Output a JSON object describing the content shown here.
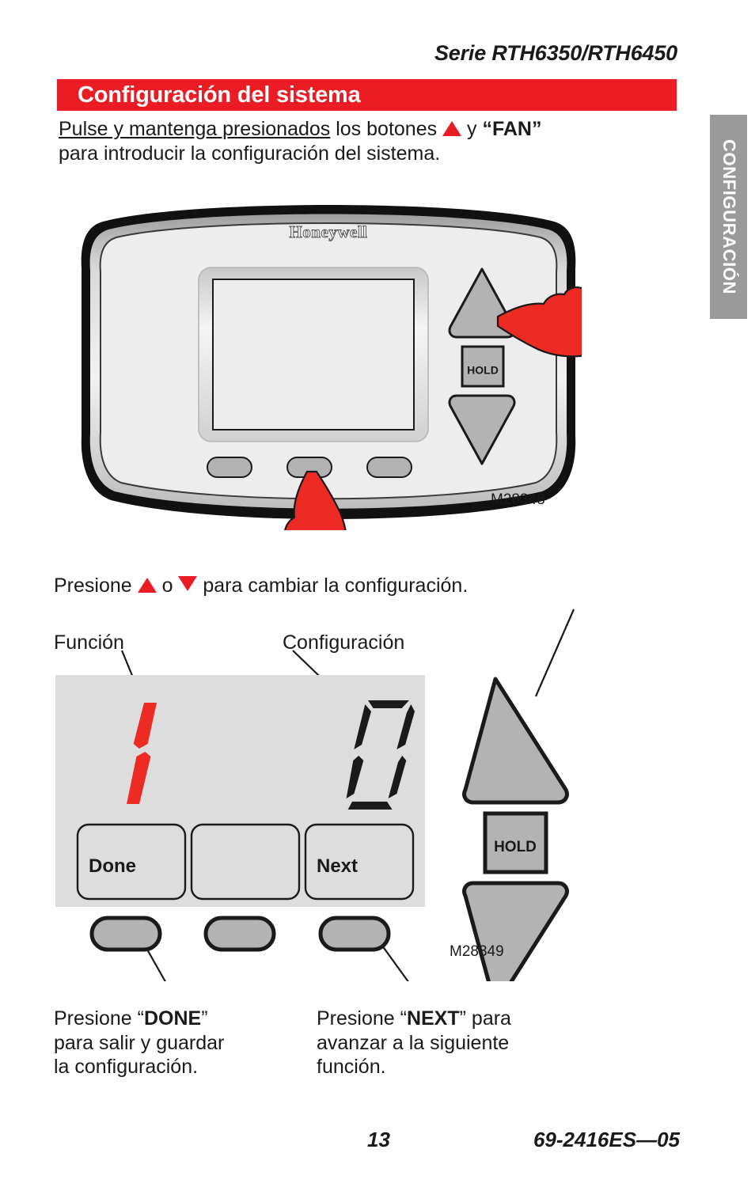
{
  "header": {
    "series": "Serie RTH6350/RTH6450",
    "banner_title": "Configuración del sistema",
    "banner_color": "#ec1c24",
    "intro_underlined": "Pulse y mantenga presionados",
    "intro_mid": " los botones ",
    "intro_up_arrow_icon": "triangle-up-red",
    "intro_join": " y ",
    "intro_fan": "“FAN”",
    "intro_line2": "para introducir la configuración del sistema."
  },
  "side_tab": {
    "label": "CONFIGURACIÓN",
    "background": "#9a9a9a",
    "text_color": "#ffffff"
  },
  "figure1": {
    "brand": "Honeywell",
    "hold_label": "HOLD",
    "code": "M28348",
    "hand_color": "#ee2a24",
    "key_color": "#b3b3b3",
    "body_color": "#eaeaea"
  },
  "middle": {
    "instruction_pre": "Presione ",
    "up_arrow_icon": "triangle-up-red",
    "instruction_o": " o ",
    "down_arrow_icon": "triangle-down-red",
    "instruction_post": " para cambiar la configuración.",
    "label_function": "Función",
    "label_setting": "Configuración"
  },
  "figure2": {
    "function_digit": "1",
    "function_digit_color": "#ee2a24",
    "setting_digit": "0",
    "setting_digit_color": "#1a1a1a",
    "softkey_done": "Done",
    "softkey_blank": "",
    "softkey_next": "Next",
    "hold_label": "HOLD",
    "code": "M28349",
    "lcd_color": "#dddddd",
    "key_color": "#b3b3b3"
  },
  "callouts": {
    "done_pre": "Presione “",
    "done_bold": "DONE",
    "done_post": "”",
    "done_line2": "para salir y guardar",
    "done_line3": "la configuración.",
    "next_pre": "Presione “",
    "next_bold": "NEXT",
    "next_post": "” para",
    "next_line2": "avanzar a la siguiente",
    "next_line3": "función."
  },
  "footer": {
    "page_number": "13",
    "document_code": "69-2416ES—05"
  }
}
